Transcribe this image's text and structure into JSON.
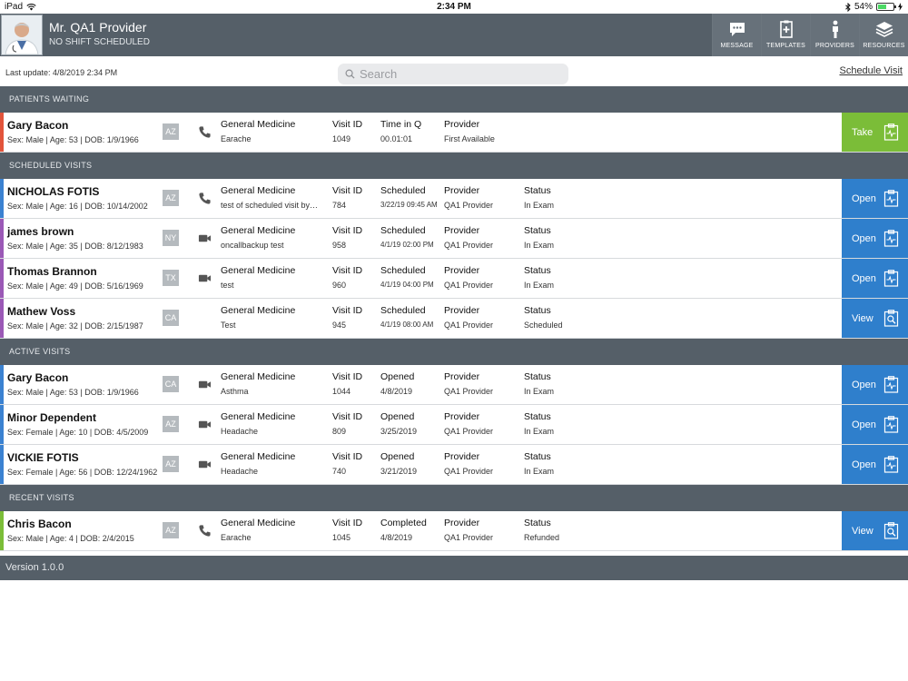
{
  "status_bar": {
    "device": "iPad",
    "time": "2:34 PM",
    "battery": "54%",
    "battery_level": 0.54
  },
  "header": {
    "provider_name": "Mr. QA1 Provider",
    "shift": "NO SHIFT SCHEDULED",
    "nav": [
      {
        "label": "MESSAGE",
        "icon": "message-icon"
      },
      {
        "label": "TEMPLATES",
        "icon": "clipboard-plus-icon"
      },
      {
        "label": "PROVIDERS",
        "icon": "person-icon"
      },
      {
        "label": "RESOURCES",
        "icon": "layers-icon"
      }
    ]
  },
  "toolbar": {
    "last_update": "Last update: 4/8/2019 2:34 PM",
    "search_placeholder": "Search",
    "schedule_visit": "Schedule Visit"
  },
  "sections": {
    "waiting": {
      "title": "PATIENTS WAITING",
      "rows": [
        {
          "name": "Gary Bacon",
          "info": "Sex: Male | Age: 53 | DOB: 1/9/1966",
          "state": "AZ",
          "comm": "phone-icon",
          "specialty": "General Medicine",
          "reason": "Earache",
          "visit_id": "1049",
          "c3_label": "Time in Q",
          "c3_value": "00.01:01",
          "provider": "First Available",
          "status": "",
          "action": "Take",
          "color": "#e2543b"
        }
      ]
    },
    "scheduled": {
      "title": "SCHEDULED VISITS",
      "rows": [
        {
          "name": "NICHOLAS FOTIS",
          "info": "Sex: Male | Age: 16 | DOB: 10/14/2002",
          "state": "AZ",
          "comm": "phone-icon",
          "specialty": "General Medicine",
          "reason": "test of scheduled visit by…",
          "visit_id": "784",
          "c3_label": "Scheduled",
          "c3_value": "3/22/19 09:45 AM",
          "provider": "QA1 Provider",
          "status": "In Exam",
          "action": "Open",
          "color": "#3b82d1"
        },
        {
          "name": "james brown",
          "info": "Sex: Male | Age: 35 | DOB: 8/12/1983",
          "state": "NY",
          "comm": "video-icon",
          "specialty": "General Medicine",
          "reason": "oncallbackup test",
          "visit_id": "958",
          "c3_label": "Scheduled",
          "c3_value": "4/1/19 02:00 PM",
          "provider": "QA1 Provider",
          "status": "In Exam",
          "action": "Open",
          "color": "#9b59b6"
        },
        {
          "name": "Thomas Brannon",
          "info": "Sex: Male | Age: 49 | DOB: 5/16/1969",
          "state": "TX",
          "comm": "video-icon",
          "specialty": "General Medicine",
          "reason": "test",
          "visit_id": "960",
          "c3_label": "Scheduled",
          "c3_value": "4/1/19 04:00 PM",
          "provider": "QA1 Provider",
          "status": "In Exam",
          "action": "Open",
          "color": "#9b59b6"
        },
        {
          "name": "Mathew Voss",
          "info": "Sex: Male | Age: 32 | DOB: 2/15/1987",
          "state": "CA",
          "comm": "",
          "specialty": "General Medicine",
          "reason": "Test",
          "visit_id": "945",
          "c3_label": "Scheduled",
          "c3_value": "4/1/19 08:00 AM",
          "provider": "QA1 Provider",
          "status": "Scheduled",
          "action": "View",
          "color": "#9b59b6"
        }
      ]
    },
    "active": {
      "title": "ACTIVE VISITS",
      "rows": [
        {
          "name": "Gary Bacon",
          "info": "Sex: Male | Age: 53 | DOB: 1/9/1966",
          "state": "CA",
          "comm": "video-icon",
          "specialty": "General Medicine",
          "reason": "Asthma",
          "visit_id": "1044",
          "c3_label": "Opened",
          "c3_value": "4/8/2019",
          "provider": "QA1 Provider",
          "status": "In Exam",
          "action": "Open",
          "color": "#3b82d1"
        },
        {
          "name": "Minor Dependent",
          "info": "Sex: Female | Age: 10 | DOB: 4/5/2009",
          "state": "AZ",
          "comm": "video-icon",
          "specialty": "General Medicine",
          "reason": "Headache",
          "visit_id": "809",
          "c3_label": "Opened",
          "c3_value": "3/25/2019",
          "provider": "QA1 Provider",
          "status": "In Exam",
          "action": "Open",
          "color": "#3b82d1"
        },
        {
          "name": "VICKIE FOTIS",
          "info": "Sex: Female | Age: 56 | DOB: 12/24/1962",
          "state": "AZ",
          "comm": "video-icon",
          "specialty": "General Medicine",
          "reason": "Headache",
          "visit_id": "740",
          "c3_label": "Opened",
          "c3_value": "3/21/2019",
          "provider": "QA1 Provider",
          "status": "In Exam",
          "action": "Open",
          "color": "#3b82d1"
        }
      ]
    },
    "recent": {
      "title": "RECENT VISITS",
      "rows": [
        {
          "name": "Chris Bacon",
          "info": "Sex: Male | Age: 4 | DOB: 2/4/2015",
          "state": "AZ",
          "comm": "phone-icon",
          "specialty": "General Medicine",
          "reason": "Earache",
          "visit_id": "1045",
          "c3_label": "Completed",
          "c3_value": "4/8/2019",
          "provider": "QA1 Provider",
          "status": "Refunded",
          "action": "View",
          "color": "#7bbd38"
        }
      ]
    }
  },
  "column_labels": {
    "visit_id": "Visit ID",
    "provider": "Provider",
    "status": "Status"
  },
  "footer": {
    "version": "Version 1.0.0"
  }
}
